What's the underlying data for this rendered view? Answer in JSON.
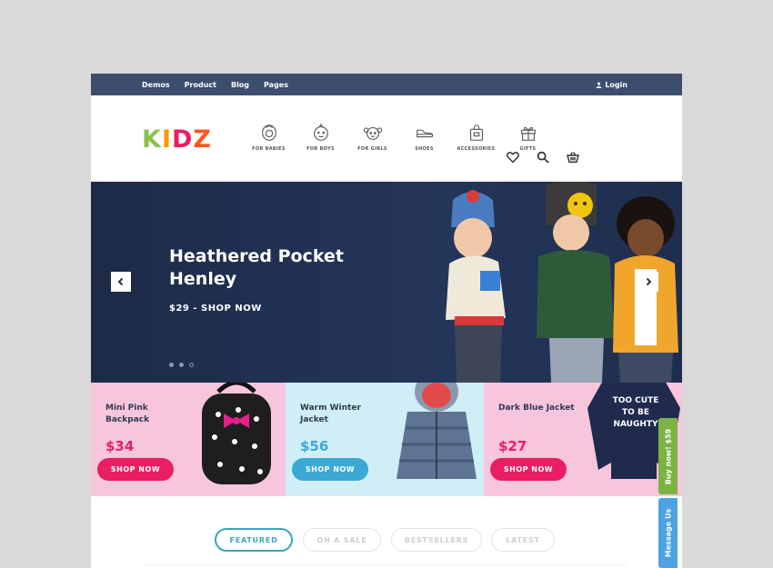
{
  "topbar": {
    "nav": [
      "Demos",
      "Product",
      "Blog",
      "Pages"
    ],
    "login": "Login"
  },
  "logo": {
    "letters": [
      {
        "char": "K",
        "color": "#8bc34a"
      },
      {
        "char": "I",
        "color": "#ff9800"
      },
      {
        "char": "D",
        "color": "#e91e63"
      },
      {
        "char": "Z",
        "color": "#ff5722"
      }
    ]
  },
  "categories": [
    {
      "label": "FOR BABIES",
      "icon": "baby-icon"
    },
    {
      "label": "FOR BOYS",
      "icon": "boy-icon"
    },
    {
      "label": "FOR GIRLS",
      "icon": "girl-icon"
    },
    {
      "label": "SHOES",
      "icon": "shoe-icon"
    },
    {
      "label": "ACCESSORIES",
      "icon": "bag-icon"
    },
    {
      "label": "GIFTS",
      "icon": "gift-icon"
    }
  ],
  "header_icons": [
    "heart-icon",
    "search-icon",
    "cart-icon"
  ],
  "hero": {
    "title": "Heathered Pocket Henley",
    "cta": "$29 - SHOP NOW",
    "slides": 3,
    "active_slide": 1
  },
  "promos": [
    {
      "name": "Mini Pink Backpack",
      "price": "$34",
      "button": "SHOP NOW",
      "bg": "#f7c6dc",
      "accent": "#e91e63"
    },
    {
      "name": "Warm Winter Jacket",
      "price": "$56",
      "button": "SHOP NOW",
      "bg": "#cfeef6",
      "accent": "#3ba9d3"
    },
    {
      "name": "Dark Blue Jacket",
      "price": "$27",
      "button": "SHOP NOW",
      "bg": "#f7c6dc",
      "accent": "#e91e63"
    }
  ],
  "shirt_text": "TOO CUTE TO BE NAUGHTY",
  "tabs": [
    {
      "label": "FEATURED",
      "active": true
    },
    {
      "label": "ON A SALE",
      "active": false
    },
    {
      "label": "BESTSELLERS",
      "active": false
    },
    {
      "label": "LATEST",
      "active": false
    }
  ],
  "side": {
    "buy": "Buy now! $59",
    "message": "Message Us"
  }
}
